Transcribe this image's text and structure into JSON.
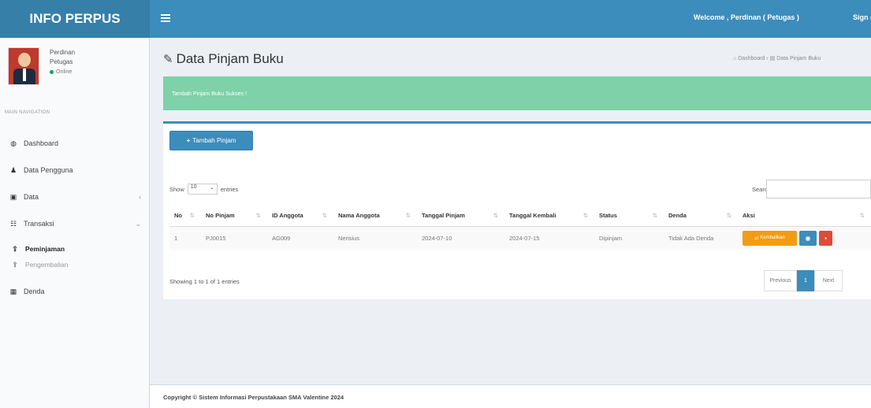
{
  "header": {
    "logo": "INFO PERPUS",
    "welcome": "Welcome , Perdinan ( Petugas )",
    "signout": "Sign out"
  },
  "sidebar": {
    "user_name": "Perdinan",
    "user_role": "Petugas",
    "user_status": "Online",
    "nav_header": "MAIN NAVIGATION",
    "items": [
      {
        "label": "Dashboard",
        "icon": "dashboard-icon"
      },
      {
        "label": "Data Pengguna",
        "icon": "user-icon"
      },
      {
        "label": "Data",
        "icon": "database-icon"
      },
      {
        "label": "Transaksi",
        "icon": "list-icon"
      },
      {
        "label": "Peminjaman",
        "icon": "upload-icon"
      },
      {
        "label": "Pengembalian",
        "icon": "upload-icon"
      },
      {
        "label": "Denda",
        "icon": "table-icon"
      }
    ]
  },
  "main": {
    "title": "Data Pinjam Buku",
    "breadcrumb_home": "Dashboard",
    "breadcrumb_current": "Data Pinjam Buku",
    "alert": "Tambah Pinjam Buku Sukses !",
    "add_button": "Tambah Pinjam",
    "show_label": "Show",
    "entries_value": "10",
    "entries_label": "entries",
    "search_label": "Search:",
    "columns": [
      "No",
      "No Pinjam",
      "ID Anggota",
      "Nama Anggota",
      "Tanggal Pinjam",
      "Tanggal Kembali",
      "Status",
      "Denda",
      "Aksi"
    ],
    "rows": [
      {
        "no": "1",
        "no_pinjam": "PJ0015",
        "id_anggota": "AG009",
        "nama": "Nerisius",
        "tgl_pinjam": "2024-07-10",
        "tgl_kembali": "2024-07-15",
        "status": "Dipinjam",
        "denda": "Tidak Ada Denda",
        "btn_kembali": "Kembalikan"
      }
    ],
    "showing": "Showing 1 to 1 of 1 entries",
    "prev": "Previous",
    "page": "1",
    "next": "Next"
  },
  "footer": "Copyright © Sistem Informasi Perpustakaan SMA Valentine 2024",
  "colors": {
    "primary": "#3c8dbc",
    "alert": "#7ed1a8",
    "warning": "#f39c12",
    "danger": "#dd4b39"
  }
}
